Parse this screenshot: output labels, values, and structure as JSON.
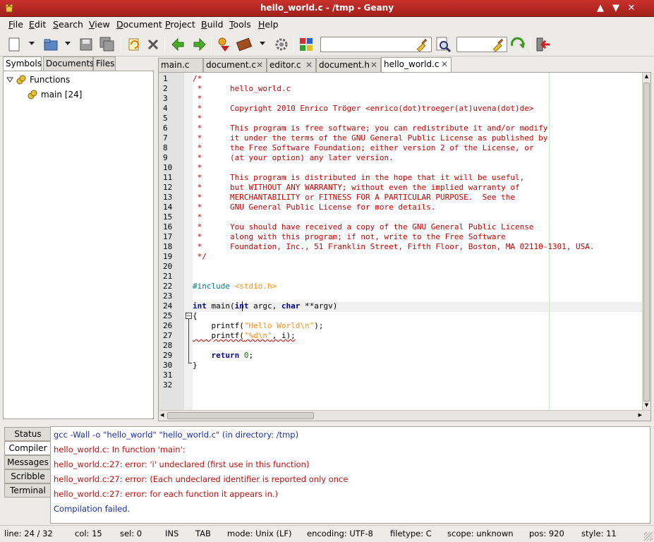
{
  "window": {
    "title": "hello_world.c - /tmp - Geany"
  },
  "menu": [
    "File",
    "Edit",
    "Search",
    "View",
    "Document",
    "Project",
    "Build",
    "Tools",
    "Help"
  ],
  "toolbar": {
    "icons": [
      "new-icon",
      "open-icon",
      "save-icon",
      "save-all-icon",
      "revert-icon",
      "close-icon",
      "back-icon",
      "forward-icon",
      "compile-icon",
      "build-icon",
      "execute-icon",
      "color-icon",
      "search-icon",
      "jump-icon",
      "quit-icon"
    ],
    "search_value": "",
    "goto_value": ""
  },
  "sidebar": {
    "tabs": [
      "Symbols",
      "Documents",
      "Files"
    ],
    "active_tab": "Symbols",
    "tree": [
      {
        "label": "Functions"
      },
      {
        "label": "main [24]"
      }
    ]
  },
  "editor": {
    "tabs": [
      {
        "label": "main.c"
      },
      {
        "label": "document.c"
      },
      {
        "label": "editor.c"
      },
      {
        "label": "document.h"
      },
      {
        "label": "hello_world.c",
        "active": true
      }
    ],
    "lines": [
      "1",
      "2",
      "3",
      "4",
      "5",
      "6",
      "7",
      "8",
      "9",
      "10",
      "11",
      "12",
      "13",
      "14",
      "15",
      "16",
      "17",
      "18",
      "19",
      "20",
      "21",
      "22",
      "23",
      "24",
      "25",
      "26",
      "27",
      "28",
      "29",
      "30",
      "31",
      "32"
    ],
    "comment_lines": [
      "/*",
      " *      hello_world.c",
      " *",
      " *      Copyright 2010 Enrico Tröger <enrico(dot)troeger(at)uvena(dot)de>",
      " *",
      " *      This program is free software; you can redistribute it and/or modify",
      " *      it under the terms of the GNU General Public License as published by",
      " *      the Free Software Foundation; either version 2 of the License, or",
      " *      (at your option) any later version.",
      " *",
      " *      This program is distributed in the hope that it will be useful,",
      " *      but WITHOUT ANY WARRANTY; without even the implied warranty of",
      " *      MERCHANTABILITY or FITNESS FOR A PARTICULAR PURPOSE.  See the",
      " *      GNU General Public License for more details.",
      " *",
      " *      You should have received a copy of the GNU General Public License",
      " *      along with this program; if not, write to the Free Software",
      " *      Foundation, Inc., 51 Franklin Street, Fifth Floor, Boston, MA 02110-1301, USA.",
      " */"
    ],
    "code": {
      "include_kw": "#include",
      "include_file": "<stdio.h>",
      "l24_kw1": "int",
      "l24_a": " main(",
      "l24_kw2": "int",
      "l24_b": " argc, ",
      "l24_kw3": "char",
      "l24_c": " **argv)",
      "l25": "{",
      "l26_a": "    printf(",
      "l26_str": "\"Hello World\\n\"",
      "l26_b": ");",
      "l27_a": "    printf(",
      "l27_str": "\"%d\\n\"",
      "l27_b": ", i);",
      "l29_kw": "return",
      "l29_num": "0",
      "l29_b": ";",
      "l30": "}"
    }
  },
  "messages": {
    "tabs": [
      "Status",
      "Compiler",
      "Messages",
      "Scribble",
      "Terminal"
    ],
    "active_tab": "Compiler",
    "lines": [
      {
        "text": "gcc -Wall -o \"hello_world\" \"hello_world.c\" (in directory: /tmp)",
        "color": "blue"
      },
      {
        "text": "hello_world.c: In function 'main':",
        "color": "red"
      },
      {
        "text": "hello_world.c:27: error: 'i' undeclared (first use in this function)",
        "color": "red"
      },
      {
        "text": "hello_world.c:27: error: (Each undeclared identifier is reported only once",
        "color": "red"
      },
      {
        "text": "hello_world.c:27: error: for each function it appears in.)",
        "color": "red"
      },
      {
        "text": "Compilation failed.",
        "color": "blue"
      }
    ]
  },
  "status": {
    "line": "line: 24 / 32",
    "col": "col: 15",
    "sel": "sel: 0",
    "ins": "INS",
    "tab": "TAB",
    "mode": "mode: Unix (LF)",
    "encoding": "encoding: UTF-8",
    "filetype": "filetype: C",
    "scope": "scope: unknown",
    "pos": "pos: 920",
    "style": "style: 11"
  },
  "colors": {
    "titlebar": "#b82a25",
    "comment": "#c80000",
    "keyword": "#00008b",
    "string": "#ff901e",
    "preprocessor": "#007f7f",
    "number": "#007f00"
  }
}
